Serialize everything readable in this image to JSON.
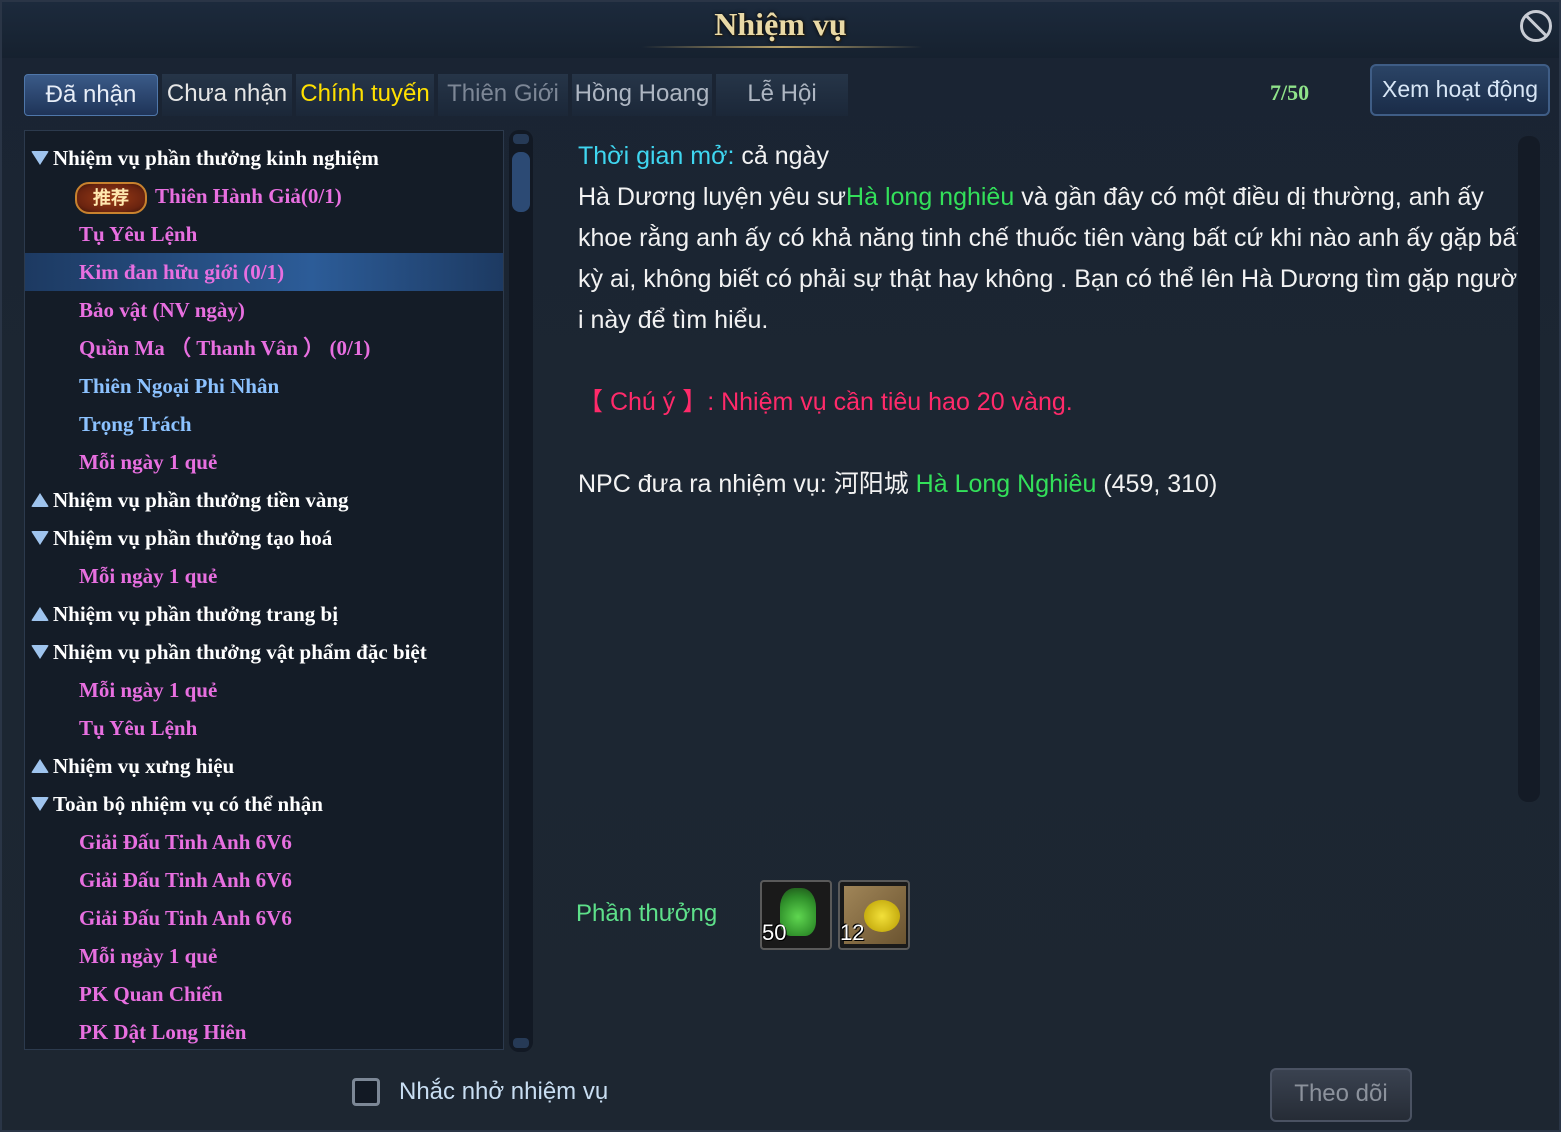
{
  "window": {
    "title": "Nhiệm vụ"
  },
  "tabs": [
    {
      "label": "Đã nhận"
    },
    {
      "label": "Chưa nhận"
    },
    {
      "label": "Chính tuyến"
    },
    {
      "label": "Thiên Giới"
    },
    {
      "label": "Hồng Hoang"
    },
    {
      "label": "Lễ Hội"
    }
  ],
  "counter": "7/50",
  "activity_button": "Xem hoạt động",
  "quest_list": {
    "recommend_badge": "推荐",
    "rows": [
      {
        "label": "Nhiệm vụ phần thưởng kinh nghiệm"
      },
      {
        "label": "Thiên Hành Giả(0/1)"
      },
      {
        "label": "Tụ Yêu Lệnh"
      },
      {
        "label": "Kim đan hữu giới (0/1)"
      },
      {
        "label": "Bảo vật (NV ngày)"
      },
      {
        "label": "Quần Ma （ Thanh Vân ） (0/1)"
      },
      {
        "label": "Thiên Ngoại Phi Nhân"
      },
      {
        "label": "Trọng Trách"
      },
      {
        "label": "Mỗi ngày 1 quẻ"
      },
      {
        "label": "Nhiệm vụ phần thưởng tiền vàng"
      },
      {
        "label": "Nhiệm vụ phần thưởng tạo hoá"
      },
      {
        "label": "Mỗi ngày 1 quẻ"
      },
      {
        "label": "Nhiệm vụ phần thưởng trang bị"
      },
      {
        "label": "Nhiệm vụ phần thưởng vật phẩm đặc biệt"
      },
      {
        "label": "Mỗi ngày 1 quẻ"
      },
      {
        "label": "Tụ Yêu Lệnh"
      },
      {
        "label": "Nhiệm vụ xưng hiệu"
      },
      {
        "label": "Toàn bộ nhiệm vụ có thể nhận"
      },
      {
        "label": "Giải Đấu Tinh Anh 6V6"
      },
      {
        "label": "Giải Đấu Tinh Anh 6V6"
      },
      {
        "label": "Giải Đấu Tinh Anh 6V6"
      },
      {
        "label": "Mỗi ngày 1 quẻ"
      },
      {
        "label": "PK Quan Chiến"
      },
      {
        "label": "PK Dật Long Hiên"
      }
    ]
  },
  "detail": {
    "open_time_label": "Thời gian mở:",
    "open_time_value": " cả ngày",
    "desc_1a": "Hà Dương luyện yêu sư",
    "desc_1b": "Hà long nghiêu",
    "desc_1c": " và gần đây có một điều dị thường, anh ấy",
    "desc_2": "khoe rằng anh ấy có khả năng tinh chế thuốc tiên vàng bất cứ khi nào anh ấy gặp bất",
    "desc_3": " kỳ ai, không biết có phải sự thật hay không . Bạn có thể lên Hà Dương tìm gặp ngườ",
    "desc_4": "i này để tìm hiểu.",
    "note": "【 Chú ý 】: Nhiệm vụ cần tiêu hao 20 vàng.",
    "npc_label": "NPC đưa ra nhiệm vụ: 河阳城 ",
    "npc_name": "Hà Long Nghiêu",
    "npc_coords": " (459, 310)"
  },
  "rewards": {
    "label": "Phần thưởng",
    "items": [
      {
        "icon": "green-potion-icon",
        "qty": "50"
      },
      {
        "icon": "gold-coins-icon",
        "qty": "12"
      }
    ]
  },
  "footer": {
    "reminder_label": "Nhắc nhở nhiệm vụ",
    "follow_button": "Theo dõi"
  },
  "colors": {
    "quest_item": "#e86fe0",
    "quest_item_alt": "#8cc2ff",
    "highlight_green": "#33e05a",
    "note_red": "#ff2a6a",
    "open_time_cyan": "#3fd6f0"
  }
}
